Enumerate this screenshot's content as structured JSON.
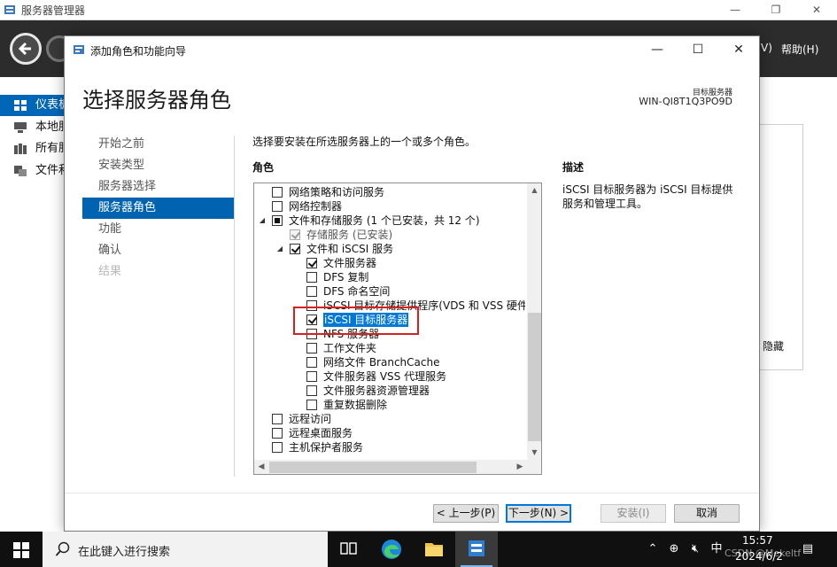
{
  "server_manager": {
    "title": "服务器管理器",
    "window_controls": {
      "minimize": "—",
      "maximize": "❐",
      "close": "✕"
    },
    "menu": {
      "view_suffix": "V)",
      "help": "帮助(H)"
    },
    "sidebar": [
      {
        "label": "仪表板",
        "icon": "dashboard-icon",
        "active": true
      },
      {
        "label": "本地服务器",
        "icon": "server-icon",
        "active": false
      },
      {
        "label": "所有服务器",
        "icon": "servers-icon",
        "active": false
      },
      {
        "label": "文件和存储服务",
        "icon": "storage-icon",
        "active": false
      }
    ],
    "right_panel_hide": "隐藏"
  },
  "wizard": {
    "title": "添加角色和功能向导",
    "heading": "选择服务器角色",
    "target_server_label": "目标服务器",
    "target_server_name": "WIN-QI8T1Q3PO9D",
    "steps": [
      {
        "label": "开始之前",
        "state": "normal"
      },
      {
        "label": "安装类型",
        "state": "normal"
      },
      {
        "label": "服务器选择",
        "state": "normal"
      },
      {
        "label": "服务器角色",
        "state": "active"
      },
      {
        "label": "功能",
        "state": "normal"
      },
      {
        "label": "确认",
        "state": "normal"
      },
      {
        "label": "结果",
        "state": "disabled"
      }
    ],
    "instruction": "选择要安装在所选服务器上的一个或多个角色。",
    "roles_header": "角色",
    "description_header": "描述",
    "description_text": "iSCSI 目标服务器为 iSCSI 目标提供服务和管理工具。",
    "roles": [
      {
        "label": "网络策略和访问服务",
        "level": 0,
        "state": "unchecked",
        "expander": ""
      },
      {
        "label": "网络控制器",
        "level": 0,
        "state": "unchecked",
        "expander": ""
      },
      {
        "label": "文件和存储服务 (1 个已安装，共 12 个)",
        "level": 0,
        "state": "indeterminate",
        "expander": "◢"
      },
      {
        "label": "存储服务 (已安装)",
        "level": 1,
        "state": "checked-gray",
        "expander": ""
      },
      {
        "label": "文件和 iSCSI 服务",
        "level": 1,
        "state": "checked",
        "expander": "◢"
      },
      {
        "label": "文件服务器",
        "level": 2,
        "state": "checked",
        "expander": ""
      },
      {
        "label": "DFS 复制",
        "level": 2,
        "state": "unchecked",
        "expander": ""
      },
      {
        "label": "DFS 命名空间",
        "level": 2,
        "state": "unchecked",
        "expander": ""
      },
      {
        "label": "iSCSI 目标存储提供程序(VDS 和 VSS 硬件提",
        "level": 2,
        "state": "unchecked",
        "expander": ""
      },
      {
        "label": "iSCSI 目标服务器",
        "level": 2,
        "state": "checked",
        "expander": "",
        "selected": true
      },
      {
        "label": "NFS 服务器",
        "level": 2,
        "state": "unchecked",
        "expander": ""
      },
      {
        "label": "工作文件夹",
        "level": 2,
        "state": "unchecked",
        "expander": ""
      },
      {
        "label": "网络文件 BranchCache",
        "level": 2,
        "state": "unchecked",
        "expander": ""
      },
      {
        "label": "文件服务器 VSS 代理服务",
        "level": 2,
        "state": "unchecked",
        "expander": ""
      },
      {
        "label": "文件服务器资源管理器",
        "level": 2,
        "state": "unchecked",
        "expander": ""
      },
      {
        "label": "重复数据删除",
        "level": 2,
        "state": "unchecked",
        "expander": ""
      },
      {
        "label": "远程访问",
        "level": 0,
        "state": "unchecked",
        "expander": ""
      },
      {
        "label": "远程桌面服务",
        "level": 0,
        "state": "unchecked",
        "expander": ""
      },
      {
        "label": "主机保护者服务",
        "level": 0,
        "state": "unchecked",
        "expander": ""
      }
    ],
    "buttons": {
      "previous": "< 上一步(P)",
      "next": "下一步(N) >",
      "install": "安装(I)",
      "cancel": "取消"
    }
  },
  "taskbar": {
    "search_placeholder": "在此键入进行搜索",
    "tray_ime": "中",
    "time": "15:57",
    "date": "2024/6/2",
    "watermark": "CSDN @Mekeltf"
  },
  "colors": {
    "accent": "#0063b1",
    "selection": "#0078d7",
    "highlight_box": "#d32222",
    "header_dark": "#2c2c2c"
  }
}
